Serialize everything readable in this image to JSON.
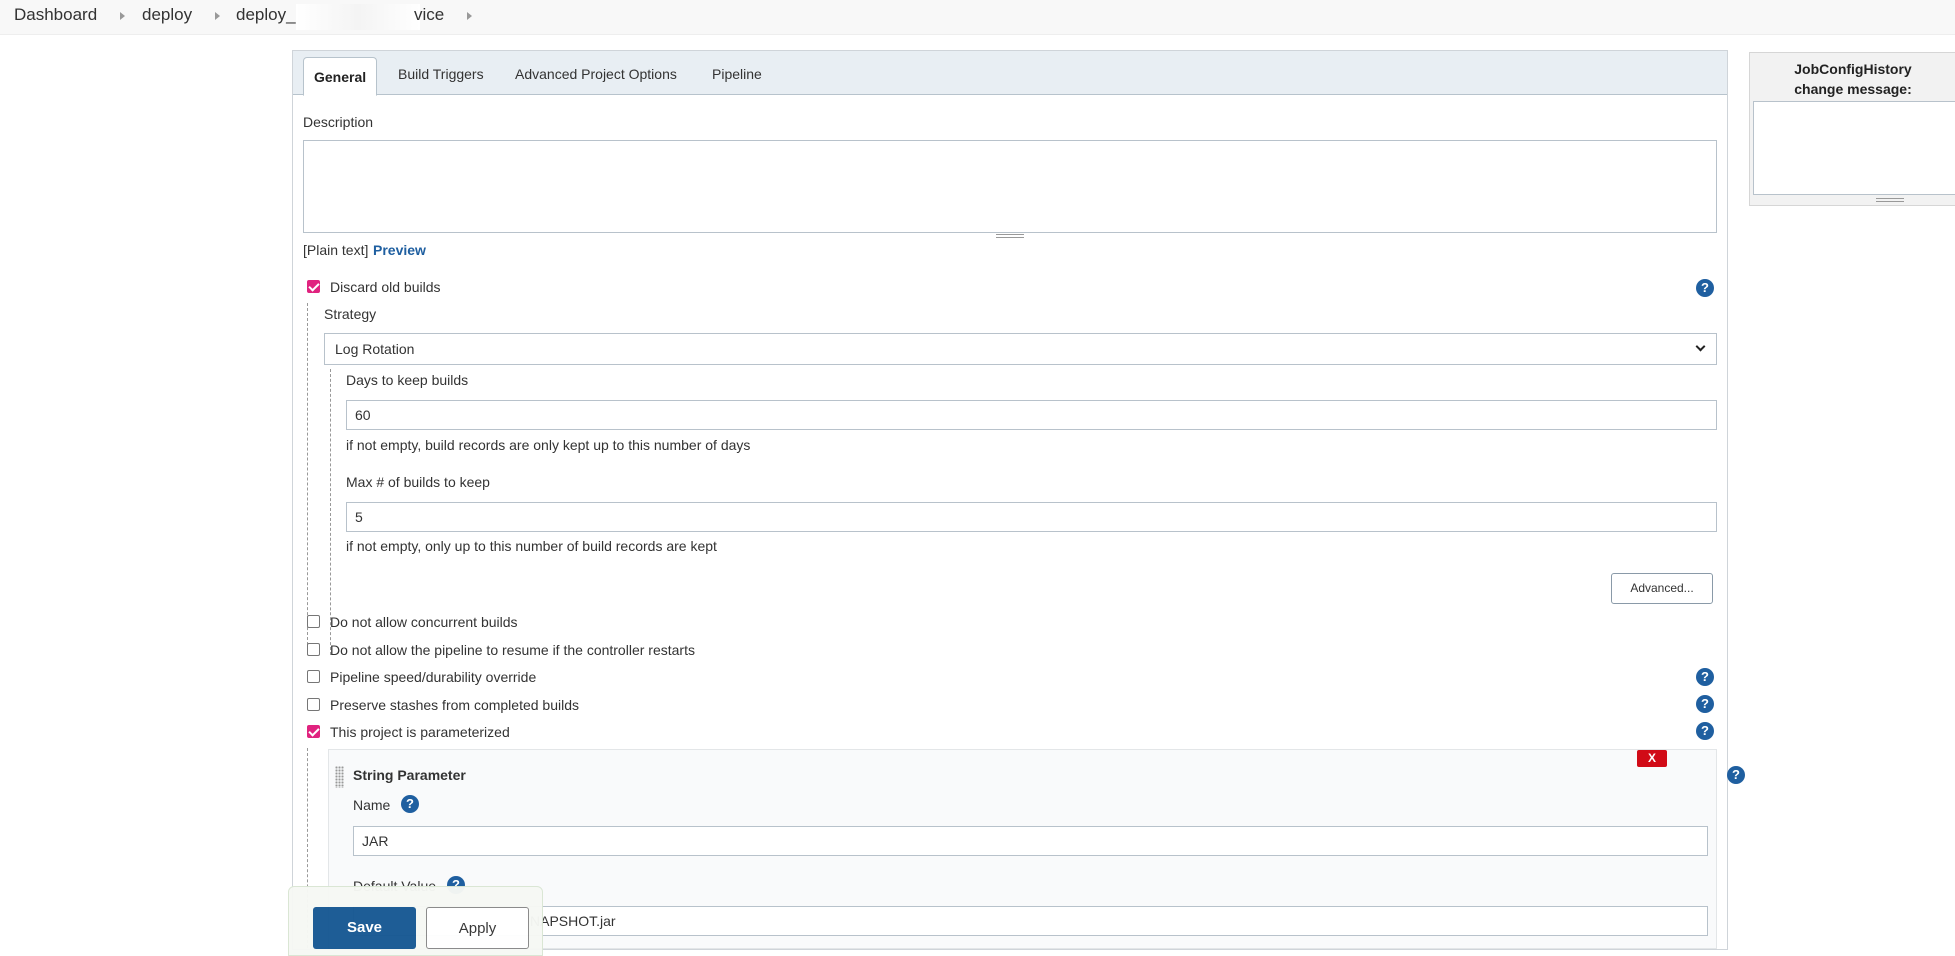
{
  "breadcrumb": {
    "items": [
      "Dashboard",
      "deploy",
      "deploy_",
      "vice"
    ]
  },
  "tabs": [
    {
      "label": "General",
      "active": true
    },
    {
      "label": "Build Triggers",
      "active": false
    },
    {
      "label": "Advanced Project Options",
      "active": false
    },
    {
      "label": "Pipeline",
      "active": false
    }
  ],
  "general": {
    "description_label": "Description",
    "description_value": "",
    "plain_text": "[Plain text]",
    "preview_link": "Preview",
    "discard_old_builds": {
      "label": "Discard old builds",
      "checked": true
    },
    "strategy_label": "Strategy",
    "strategy_value": "Log Rotation",
    "days_label": "Days to keep builds",
    "days_value": "60",
    "days_hint": "if not empty, build records are only kept up to this number of days",
    "max_label": "Max # of builds to keep",
    "max_value": "5",
    "max_hint": "if not empty, only up to this number of build records are kept",
    "advanced_button": "Advanced...",
    "options": [
      {
        "label": "Do not allow concurrent builds",
        "checked": false
      },
      {
        "label": "Do not allow the pipeline to resume if the controller restarts",
        "checked": false
      },
      {
        "label": "Pipeline speed/durability override",
        "checked": false
      },
      {
        "label": "Preserve stashes from completed builds",
        "checked": false
      },
      {
        "label": "This project is parameterized",
        "checked": true
      }
    ],
    "string_parameter": {
      "title": "String Parameter",
      "delete_label": "X",
      "name_label": "Name",
      "name_value": "JAR",
      "default_label": "Default Value",
      "default_value": "NAPSHOT.jar"
    }
  },
  "history": {
    "title_line1": "JobConfigHistory",
    "title_line2": "change message:"
  },
  "footer": {
    "save_label": "Save",
    "apply_label": "Apply"
  },
  "icons": {
    "help": "?"
  },
  "colors": {
    "accent": "#175893",
    "checkbox_checked": "#e0237f",
    "help_icon": "#1f5fa0",
    "delete": "#d10b17"
  }
}
